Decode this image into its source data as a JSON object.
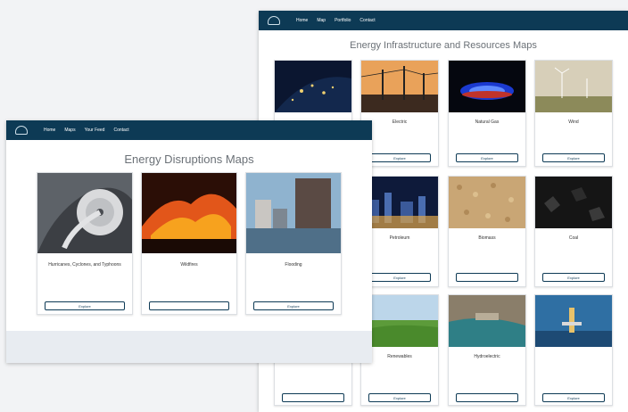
{
  "back_window": {
    "nav": {
      "logo_lines": [
        "",
        ""
      ],
      "links": [
        "Home",
        "Map",
        "Portfolio",
        "Contact"
      ]
    },
    "title": "Energy Infrastructure and Resources Maps",
    "cards": [
      {
        "title": "",
        "desc": "",
        "button": ""
      },
      {
        "title": "Electric",
        "desc": "",
        "button": "Explore"
      },
      {
        "title": "Natural Gas",
        "desc": "",
        "button": "Explore"
      },
      {
        "title": "Wind",
        "desc": "",
        "button": "Explore"
      },
      {
        "title": "Petroleum",
        "desc": "",
        "button": "Explore"
      },
      {
        "title": "Biomass",
        "desc": "",
        "button": ""
      },
      {
        "title": "Coal",
        "desc": "",
        "button": "Explore"
      },
      {
        "title": "",
        "desc": "",
        "button": ""
      },
      {
        "title": "",
        "desc": "",
        "button": ""
      },
      {
        "title": "Renewables",
        "desc": "",
        "button": "Explore"
      },
      {
        "title": "Hydroelectric",
        "desc": "",
        "button": ""
      },
      {
        "title": "",
        "desc": "",
        "button": "Explore"
      }
    ]
  },
  "front_window": {
    "nav": {
      "logo_lines": [
        "",
        ""
      ],
      "links": [
        "Home",
        "Maps",
        "Your Feed",
        "Contact"
      ]
    },
    "title": "Energy Disruptions Maps",
    "cards": [
      {
        "title": "Hurricanes, Cyclones, and Typhoons",
        "desc": "",
        "button": "Explore"
      },
      {
        "title": "Wildfires",
        "desc": "",
        "button": ""
      },
      {
        "title": "Flooding",
        "desc": "",
        "button": "Explore"
      }
    ],
    "footer": {
      "line1": "",
      "links": [
        "",
        ""
      ]
    }
  },
  "colors": {
    "nav": "#0d3a55",
    "title": "#6b7177",
    "footer": "#e8ecf1"
  }
}
